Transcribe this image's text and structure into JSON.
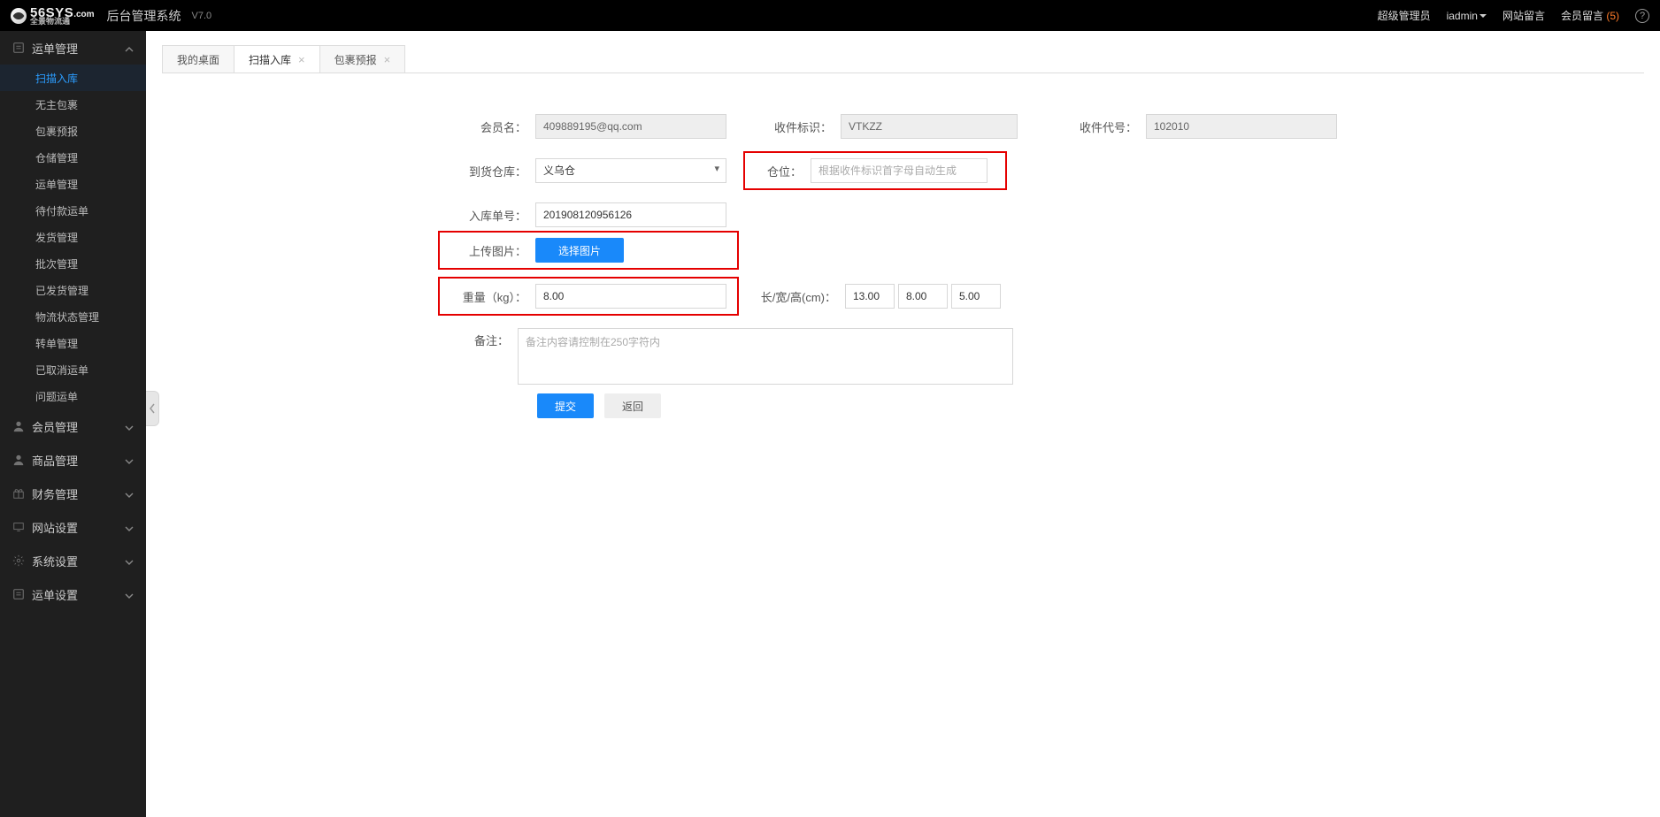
{
  "header": {
    "logo_main": "56SYS",
    "logo_dom": ".com",
    "logo_sub": "全景物流通",
    "system_title": "后台管理系统",
    "version": "V7.0",
    "role": "超级管理员",
    "user": "iadmin",
    "site_msg": "网站留言",
    "member_msg": "会员留言",
    "member_msg_count": "(5)"
  },
  "sidebar": {
    "groups": [
      {
        "icon": "doc",
        "label": "运单管理",
        "expanded": true,
        "items": [
          "扫描入库",
          "无主包裹",
          "包裹预报",
          "仓储管理",
          "运单管理",
          "待付款运单",
          "发货管理",
          "批次管理",
          "已发货管理",
          "物流状态管理",
          "转单管理",
          "已取消运单",
          "问题运单"
        ],
        "active_index": 0
      },
      {
        "icon": "user",
        "label": "会员管理",
        "expanded": false
      },
      {
        "icon": "user",
        "label": "商品管理",
        "expanded": false
      },
      {
        "icon": "gift",
        "label": "财务管理",
        "expanded": false
      },
      {
        "icon": "monitor",
        "label": "网站设置",
        "expanded": false
      },
      {
        "icon": "gear",
        "label": "系统设置",
        "expanded": false
      },
      {
        "icon": "doc",
        "label": "运单设置",
        "expanded": false
      }
    ]
  },
  "tabs": [
    {
      "label": "我的桌面",
      "closable": false,
      "active": false
    },
    {
      "label": "扫描入库",
      "closable": true,
      "active": true
    },
    {
      "label": "包裹预报",
      "closable": true,
      "active": false
    }
  ],
  "form": {
    "member_label": "会员名：",
    "member_value": "409889195@qq.com",
    "recv_tag_label": "收件标识：",
    "recv_tag_value": "VTKZZ",
    "recv_code_label": "收件代号：",
    "recv_code_value": "102010",
    "warehouse_label": "到货仓库：",
    "warehouse_value": "义乌仓",
    "bin_label": "仓位：",
    "bin_placeholder": "根据收件标识首字母自动生成",
    "inbound_label": "入库单号：",
    "inbound_value": "201908120956126",
    "upload_label": "上传图片：",
    "upload_btn": "选择图片",
    "weight_label": "重量（kg）：",
    "weight_value": "8.00",
    "dims_label": "长/宽/高(cm)：",
    "dim_l": "13.00",
    "dim_w": "8.00",
    "dim_h": "5.00",
    "remark_label": "备注：",
    "remark_placeholder": "备注内容请控制在250字符内",
    "submit": "提交",
    "back": "返回"
  }
}
